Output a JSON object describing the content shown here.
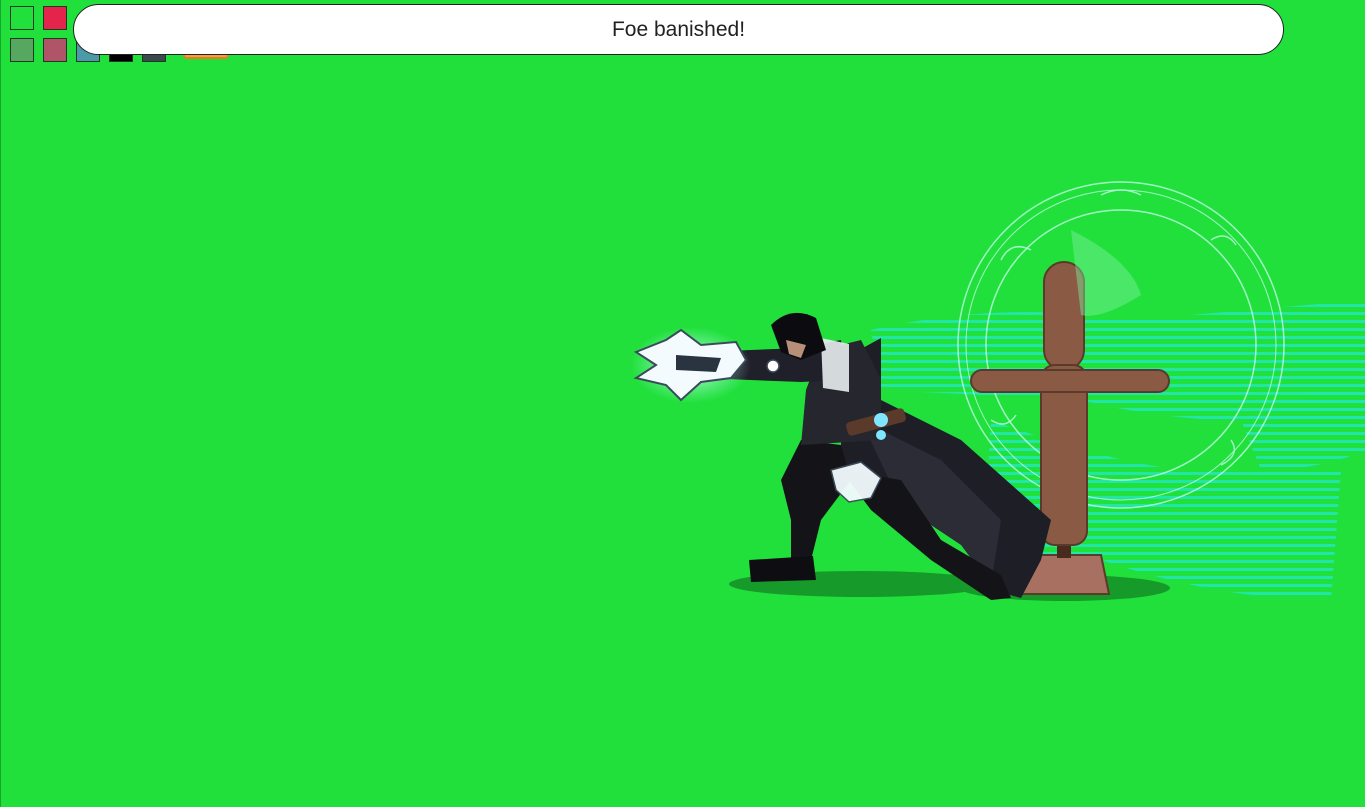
{
  "toast": {
    "message": "Foe banished!"
  },
  "palette": {
    "swatches": [
      {
        "color": "#22e03c",
        "row": 1
      },
      {
        "color": "#e4244a",
        "row": 1
      },
      {
        "color": "#56a860",
        "row": 2
      },
      {
        "color": "#b05468",
        "row": 2
      },
      {
        "color": "#4a9aa8",
        "row": 2
      },
      {
        "color": "#000000",
        "row": 2
      },
      {
        "color": "#3a4a4a",
        "row": 2
      }
    ]
  },
  "colors": {
    "background": "#22e03c",
    "toast_bg": "#ffffff",
    "effect_cyan": "#22e8c8",
    "dummy_wood": "#8a5a44"
  },
  "scene": {
    "character": "dark-cloaked-hero",
    "weapon": "spiked-crystal-claws",
    "target": "training-dummy",
    "effect": "banish-magic-circle"
  }
}
